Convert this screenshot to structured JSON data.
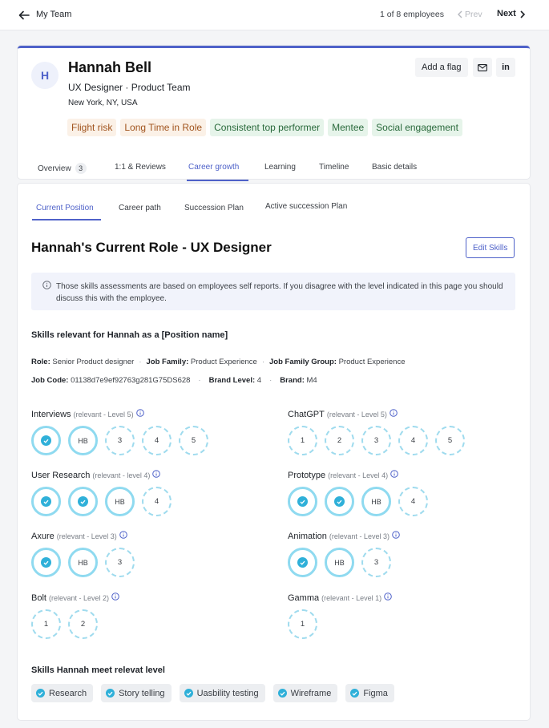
{
  "topbar": {
    "back_label": "My Team",
    "count": "1 of 8 employees",
    "prev": "Prev",
    "next": "Next"
  },
  "profile": {
    "initial": "H",
    "name": "Hannah Bell",
    "role": "UX Designer · Product Team",
    "location": "New York, NY, USA",
    "add_flag": "Add a flag",
    "linkedin": "in",
    "flags": [
      {
        "label": "Flight risk",
        "kind": "warn"
      },
      {
        "label": "Long Time in Role",
        "kind": "warn"
      },
      {
        "label": "Consistent top performer",
        "kind": "good"
      },
      {
        "label": "Mentee",
        "kind": "good"
      },
      {
        "label": "Social engagement",
        "kind": "good"
      }
    ]
  },
  "tabs": [
    {
      "label": "Overview",
      "badge": "3"
    },
    {
      "label": "1:1 & Reviews"
    },
    {
      "label": "Career growth",
      "active": true
    },
    {
      "label": "Learning"
    },
    {
      "label": "Timeline"
    },
    {
      "label": "Basic details"
    }
  ],
  "subtabs": [
    {
      "label": "Current Position",
      "active": true
    },
    {
      "label": "Career path"
    },
    {
      "label": "Succession Plan"
    },
    {
      "label": "Active succession Plan"
    }
  ],
  "section": {
    "title": "Hannah's Current Role - UX Designer",
    "edit_skills": "Edit Skills",
    "info": "Those skills assessments are based on employees self reports.  If you disagree with the level indicated in this page you should discuss this with the employee.",
    "skills_heading": "Skills relevant for Hannah as a [Position name]",
    "meta_row1": [
      {
        "key": "Role:",
        "value": "Senior Product designer"
      },
      {
        "key": "Job Family:",
        "value": "Product Experience"
      },
      {
        "key": "Job Family Group:",
        "value": "Product Experience"
      }
    ],
    "meta_row2": [
      {
        "key": "Job Code:",
        "value": "01138d7e9ef92763g281G75DS628"
      },
      {
        "key": "Brand Level:",
        "value": "4"
      },
      {
        "key": "Brand:",
        "value": "M4"
      }
    ]
  },
  "skills": [
    {
      "name": "Interviews",
      "rel": "(relevant - Level 5)",
      "circles": [
        "done",
        "HB",
        "3",
        "4",
        "5"
      ]
    },
    {
      "name": "ChatGPT",
      "rel": "(relevant - Level 5)",
      "circles": [
        "1",
        "2",
        "3",
        "4",
        "5"
      ]
    },
    {
      "name": "User Research",
      "rel": "(relevant - level 4)",
      "circles": [
        "done",
        "done",
        "HB",
        "4"
      ]
    },
    {
      "name": "Prototype",
      "rel": "(relevant - Level 4)",
      "circles": [
        "done",
        "done",
        "HB",
        "4"
      ]
    },
    {
      "name": "Axure",
      "rel": "(relevant - Level 3)",
      "circles": [
        "done",
        "HB",
        "3"
      ]
    },
    {
      "name": "Animation",
      "rel": "(relevant - Level 3)",
      "circles": [
        "done",
        "HB",
        "3"
      ]
    },
    {
      "name": "Bolt",
      "rel": "(relevant - Level 2)",
      "circles": [
        "1",
        "2"
      ]
    },
    {
      "name": "Gamma",
      "rel": "(relevant - Level 1)",
      "circles": [
        "1"
      ]
    }
  ],
  "meet": {
    "heading": "Skills Hannah meet relevat level",
    "chips": [
      "Research",
      "Story telling",
      "Uasbility testing",
      "Wireframe",
      "Figma"
    ]
  },
  "colors": {
    "accent": "#4f62c9",
    "skill_fill": "#2fb0d9",
    "skill_ring": "#8fdaf0"
  }
}
